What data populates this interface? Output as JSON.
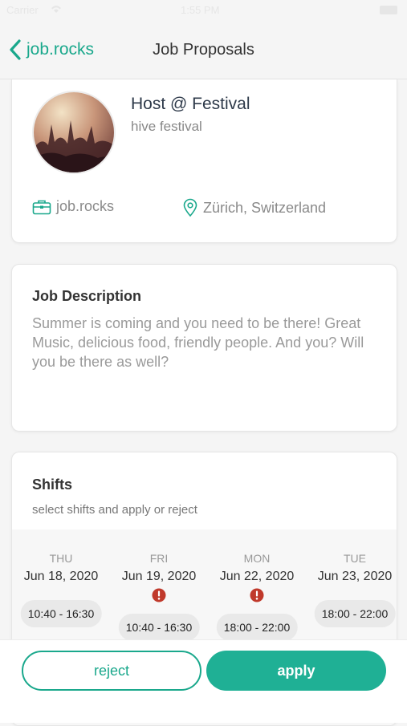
{
  "status_bar": {
    "carrier": "Carrier",
    "time": "1:55 PM"
  },
  "nav": {
    "back_label": "job.rocks",
    "title": "Job Proposals"
  },
  "job": {
    "title": "Host @ Festival",
    "company": "hive festival",
    "employer": "job.rocks",
    "location": "Zürich, Switzerland"
  },
  "description": {
    "heading": "Job Description",
    "text": "Summer is coming and you need to be there! Great Music, delicious food, friendly people. And you? Will you be there as well?"
  },
  "shifts": {
    "heading": "Shifts",
    "subtitle": "select shifts and apply or reject",
    "columns": [
      {
        "day": "THU",
        "date": "Jun 18, 2020",
        "time": "10:40 - 16:30",
        "warning": false
      },
      {
        "day": "FRI",
        "date": "Jun 19, 2020",
        "time": "10:40 - 16:30",
        "warning": true
      },
      {
        "day": "MON",
        "date": "Jun 22, 2020",
        "time": "18:00 - 22:00",
        "warning": true
      },
      {
        "day": "TUE",
        "date": "Jun 23, 2020",
        "time": "18:00 - 22:00",
        "warning": false
      }
    ]
  },
  "actions": {
    "reject_label": "reject",
    "apply_label": "apply"
  },
  "colors": {
    "accent": "#1aa88c",
    "warning": "#c0392b"
  }
}
